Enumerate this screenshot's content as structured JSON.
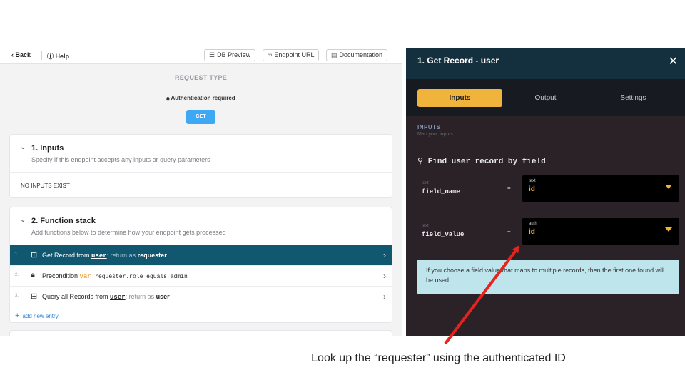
{
  "topbar": {
    "back_label": "Back",
    "help_label": "Help",
    "buttons": [
      {
        "icon": "database-icon",
        "label": "DB Preview"
      },
      {
        "icon": "link-icon",
        "label": "Endpoint URL"
      },
      {
        "icon": "document-icon",
        "label": "Documentation"
      }
    ]
  },
  "request": {
    "title": "REQUEST TYPE",
    "auth_label": "Authentication required",
    "method": "GET"
  },
  "inputs_card": {
    "title": "1. Inputs",
    "subtitle": "Specify if this endpoint accepts any inputs or query parameters",
    "empty_label": "NO INPUTS EXIST"
  },
  "function_card": {
    "title": "2. Function stack",
    "subtitle": "Add functions below to determine how your endpoint gets processed",
    "rows": [
      {
        "num": "1.",
        "prefix": "Get Record from ",
        "table": "user",
        "mid": ": return as ",
        "result": "requester"
      },
      {
        "num": "2.",
        "prefix": "Precondition ",
        "var": "var:",
        "expr": "requester.role equals admin"
      },
      {
        "num": "3.",
        "prefix": "Query all Records from ",
        "table": "user",
        "mid": ": return as ",
        "result": "user"
      }
    ],
    "add_label": "add new entry"
  },
  "panel": {
    "title": "1. Get Record - user",
    "tabs": [
      "Inputs",
      "Output",
      "Settings"
    ],
    "active_tab": "Inputs",
    "section_label": "INPUTS",
    "section_sub": "Map your inputs.",
    "find_label": "Find user record by field",
    "fields": [
      {
        "type": "text",
        "name": "field_name",
        "eq": "=",
        "value_type": "text",
        "value": "id"
      },
      {
        "type": "text",
        "name": "field_value",
        "eq": "=",
        "value_type": "auth",
        "value": "id"
      }
    ],
    "info": "If you choose a field value that maps to multiple records, then the first one found will be used."
  },
  "caption": "Look up the “requester” using the authenticated ID",
  "colors": {
    "accent": "#f0b43d",
    "active_row": "#11576f",
    "panel_header": "#14303f",
    "get_button": "#3ea8f5",
    "annotation_arrow": "#e8211c"
  }
}
